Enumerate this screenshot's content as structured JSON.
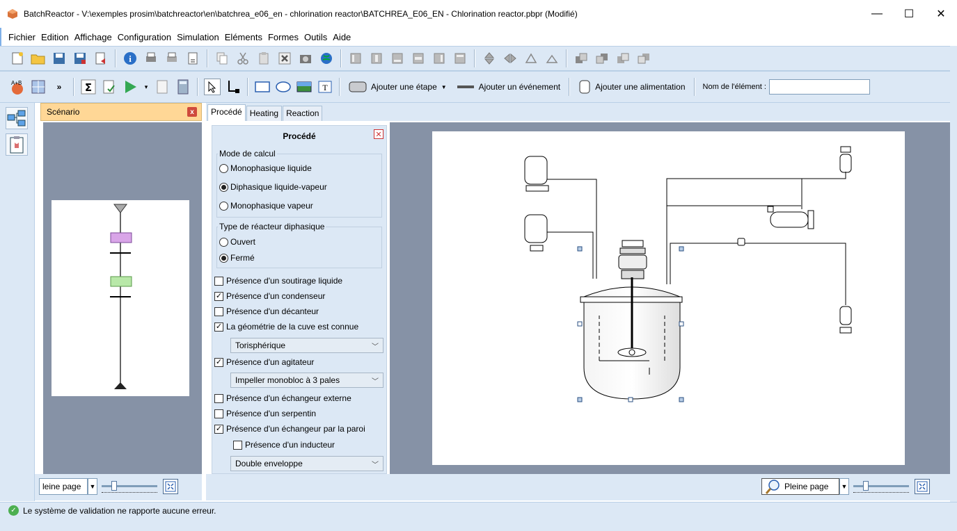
{
  "window": {
    "title": "BatchReactor - V:\\exemples prosim\\batchreactor\\en\\batchrea_e06_en - chlorination reactor\\BATCHREA_E06_EN - Chlorination reactor.pbpr (Modifié)",
    "minimize": "—",
    "maximize": "☐",
    "close": "✕"
  },
  "menu": [
    "Fichier",
    "Edition",
    "Affichage",
    "Configuration",
    "Simulation",
    "Eléments",
    "Formes",
    "Outils",
    "Aide"
  ],
  "toolbar2": {
    "add_step": "Ajouter une étape",
    "add_event": "Ajouter un événement",
    "add_feed": "Ajouter une alimentation",
    "element_name_label": "Nom de l'élément :",
    "element_name_value": ""
  },
  "scenario": {
    "tab_label": "Scénario",
    "zoom_value": "leine page"
  },
  "process_tabs": [
    "Procédé",
    "Heating",
    "Reaction"
  ],
  "form": {
    "title": "Procédé",
    "calc_mode_label": "Mode de calcul",
    "calc_modes": [
      "Monophasique liquide",
      "Diphasique liquide-vapeur",
      "Monophasique vapeur"
    ],
    "calc_mode_selected": 1,
    "reactor_type_label": "Type de réacteur diphasique",
    "reactor_types": [
      "Ouvert",
      "Fermé"
    ],
    "reactor_type_selected": 1,
    "checks": [
      {
        "label": "Présence d'un soutirage liquide",
        "checked": false
      },
      {
        "label": "Présence d'un condenseur",
        "checked": true
      },
      {
        "label": "Présence d'un décanteur",
        "checked": false
      },
      {
        "label": "La géométrie de la cuve est connue",
        "checked": true
      }
    ],
    "geometry_select": "Torisphérique",
    "agitator_check": {
      "label": "Présence d'un agitateur",
      "checked": true
    },
    "agitator_select": "Impeller monobloc à 3 pales",
    "checks2": [
      {
        "label": "Présence d'un échangeur externe",
        "checked": false
      },
      {
        "label": "Présence d'un serpentin",
        "checked": false
      },
      {
        "label": "Présence d'un échangeur par la paroi",
        "checked": true
      }
    ],
    "inductor_check": {
      "label": "Présence d'un inducteur",
      "checked": false
    },
    "wall_select": "Double enveloppe"
  },
  "main": {
    "zoom_value": "Pleine page"
  },
  "status": {
    "message": "Le système de validation ne rapporte aucune erreur."
  }
}
